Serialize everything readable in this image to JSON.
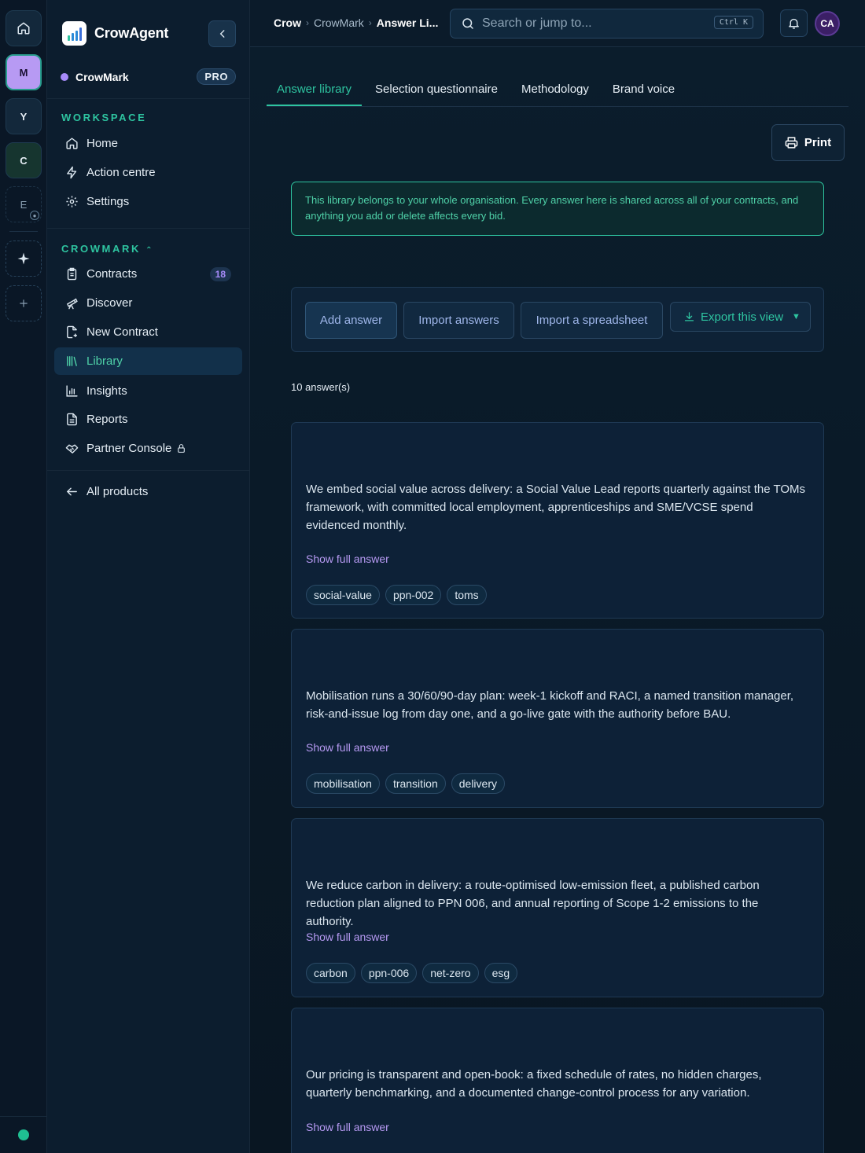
{
  "rail": {
    "items": [
      "M",
      "Y",
      "C",
      "E"
    ]
  },
  "brand": {
    "name": "CrowAgent"
  },
  "org": {
    "name": "CrowMark",
    "plan": "PRO"
  },
  "sidebar": {
    "workspace_label": "WORKSPACE",
    "workspace_items": [
      {
        "label": "Home",
        "icon": "home-icon"
      },
      {
        "label": "Action centre",
        "icon": "bolt-icon"
      },
      {
        "label": "Settings",
        "icon": "gear-icon"
      }
    ],
    "crowmark_label": "CROWMARK",
    "crowmark_items": [
      {
        "label": "Contracts",
        "icon": "clipboard-icon",
        "count": "18"
      },
      {
        "label": "Discover",
        "icon": "telescope-icon"
      },
      {
        "label": "New Contract",
        "icon": "file-plus-icon"
      },
      {
        "label": "Library",
        "icon": "library-icon",
        "active": true
      },
      {
        "label": "Insights",
        "icon": "chart-icon"
      },
      {
        "label": "Reports",
        "icon": "report-icon"
      },
      {
        "label": "Partner Console",
        "icon": "handshake-icon",
        "locked": true
      }
    ],
    "all_products": "All products"
  },
  "topbar": {
    "breadcrumb": [
      "Crow",
      "CrowMark",
      "Answer Li..."
    ],
    "search_placeholder": "Search or jump to...",
    "shortcut": "Ctrl K",
    "avatar_initials": "CA"
  },
  "tabs": [
    "Answer library",
    "Selection questionnaire",
    "Methodology",
    "Brand voice"
  ],
  "print_label": "Print",
  "notice": "This library belongs to your whole organisation. Every answer here is shared across all of your contracts, and anything you add or delete affects every bid.",
  "actions": {
    "add": "Add answer",
    "import": "Import answers",
    "spreadsheet": "Import a spreadsheet",
    "export": "Export this view"
  },
  "answer_count": "10 answer(s)",
  "show_full": "Show full answer",
  "answers": [
    {
      "text": "We embed social value across delivery: a Social Value Lead reports quarterly against the TOMs framework, with committed local employment, apprenticeships and SME/VCSE spend evidenced monthly.",
      "tags": [
        "social-value",
        "ppn-002",
        "toms"
      ]
    },
    {
      "text": "Mobilisation runs a 30/60/90-day plan: week-1 kickoff and RACI, a named transition manager, risk-and-issue log from day one, and a go-live gate with the authority before BAU.",
      "tags": [
        "mobilisation",
        "transition",
        "delivery"
      ]
    },
    {
      "text": "We reduce carbon in delivery: a route-optimised low-emission fleet, a published carbon reduction plan aligned to PPN 006, and annual reporting of Scope 1-2 emissions to the authority.",
      "tags": [
        "carbon",
        "ppn-006",
        "net-zero",
        "esg"
      ]
    },
    {
      "text": "Our pricing is transparent and open-book: a fixed schedule of rates, no hidden charges, quarterly benchmarking, and a documented change-control process for any variation.",
      "tags": []
    }
  ],
  "colors": {
    "accent": "#2ec4a0",
    "purple": "#b79af3",
    "background": "#0b1a28"
  }
}
